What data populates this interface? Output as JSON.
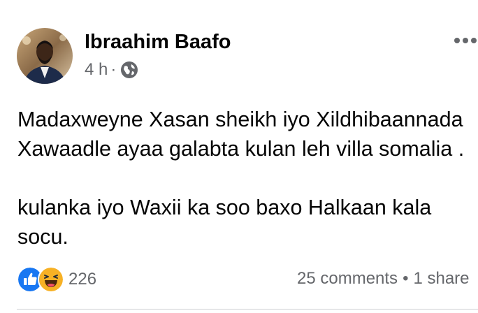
{
  "post": {
    "author": "Ibraahim Baafo",
    "time": "4 h",
    "dot": "·",
    "audience_icon": "globe-icon",
    "menu_icon": "more-options-icon",
    "body": {
      "line1": "Madaxweyne Xasan sheikh iyo Xildhibaannada",
      "line2": "Xawaadle ayaa galabta kulan leh villa somalia .",
      "line3": "kulanka iyo Waxii ka soo baxo Halkaan kala",
      "line4": "socu."
    }
  },
  "reactions": {
    "icons": [
      "like-icon",
      "haha-icon"
    ],
    "count": "226"
  },
  "stats": {
    "comments": "25 comments",
    "separator": "•",
    "shares": "1 share"
  },
  "colors": {
    "like": "#1877f2",
    "haha": "#f7b125",
    "secondary_text": "#65676b"
  }
}
